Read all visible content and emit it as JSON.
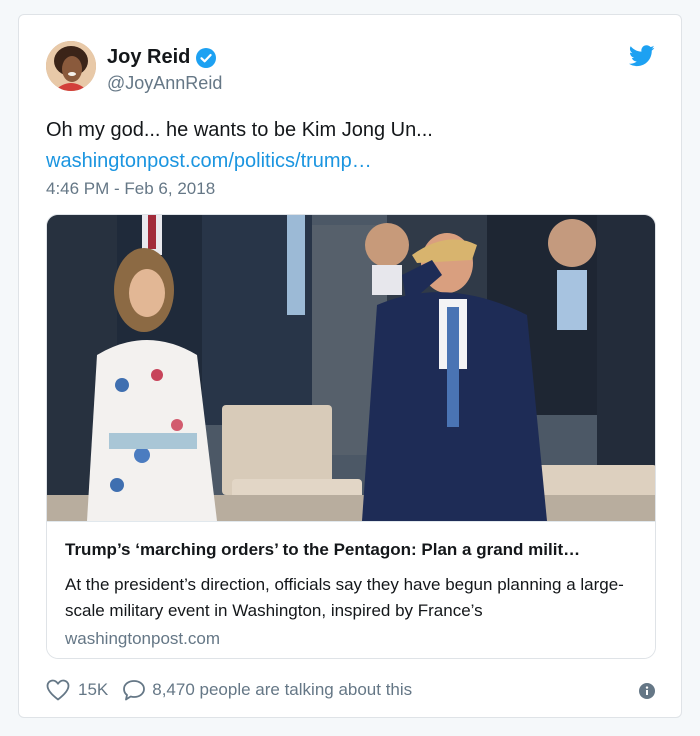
{
  "author": {
    "display_name": "Joy Reid",
    "handle": "@JoyAnnReid",
    "verified_icon": "verified-badge-icon"
  },
  "tweet": {
    "text": "Oh my god... he wants to be Kim Jong Un...",
    "link": "washingtonpost.com/politics/trump…",
    "timestamp": "4:46 PM - Feb 6, 2018"
  },
  "link_card": {
    "title": "Trump’s ‘marching orders’ to the Pentagon: Plan a grand milit…",
    "description": "At the president’s direction, officials say they have begun planning a large-scale military event in Washington, inspired by France’s",
    "domain": "washingtonpost.com"
  },
  "actions": {
    "likes": "15K",
    "talking": "8,470 people are talking about this"
  },
  "colors": {
    "link": "#1b95e0",
    "twitter_blue": "#1da1f2",
    "secondary_text": "#657786",
    "primary_text": "#14171a"
  }
}
